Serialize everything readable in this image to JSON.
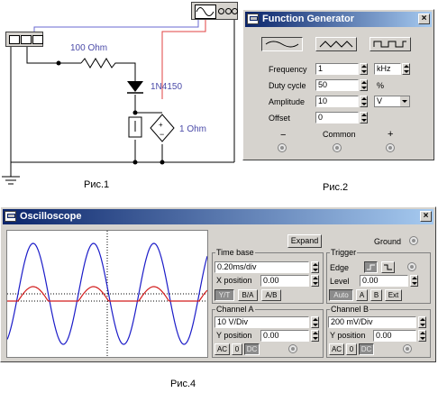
{
  "circuit": {
    "resistor_label": "100 Ohm",
    "diode_label": "1N4150",
    "source_label": "1 Ohm",
    "caption": "Рис.1"
  },
  "function_generator": {
    "title": "Function Generator",
    "caption": "Рис.2",
    "waveforms": [
      "sine-wave-icon",
      "triangle-wave-icon",
      "square-wave-icon"
    ],
    "frequency": {
      "label": "Frequency",
      "value": "1",
      "unit": "kHz"
    },
    "duty_cycle": {
      "label": "Duty cycle",
      "value": "50",
      "unit": "%"
    },
    "amplitude": {
      "label": "Amplitude",
      "value": "10",
      "unit": "V"
    },
    "offset": {
      "label": "Offset",
      "value": "0"
    },
    "terminals": {
      "minus": "−",
      "common": "Common",
      "plus": "+"
    }
  },
  "oscilloscope": {
    "title": "Oscilloscope",
    "caption": "Рис.4",
    "expand_label": "Expand",
    "ground_label": "Ground",
    "timebase": {
      "title": "Time base",
      "value": "0.20ms/div",
      "xpos_label": "X position",
      "xpos_value": "0.00",
      "modes": [
        "Y/T",
        "B/A",
        "A/B"
      ]
    },
    "trigger": {
      "title": "Trigger",
      "edge_label": "Edge",
      "level_label": "Level",
      "level_value": "0.00",
      "modes": [
        "Auto",
        "A",
        "B",
        "Ext"
      ]
    },
    "channel_a": {
      "title": "Channel A",
      "value": "10  V/Div",
      "ypos_label": "Y position",
      "ypos_value": "0.00",
      "coupling": [
        "AC",
        "0",
        "DC"
      ]
    },
    "channel_b": {
      "title": "Channel B",
      "value": "200 mV/Div",
      "ypos_label": "Y position",
      "ypos_value": "0.00",
      "coupling": [
        "AC",
        "0",
        "DC"
      ]
    },
    "traces": {
      "channel_a_color": "#1c1cc8",
      "channel_b_color": "#d21c1c"
    }
  },
  "colors": {
    "title_start": "#0a246a",
    "title_end": "#a6caf0",
    "window_bg": "#d6d3ce",
    "wire_blue": "#6a6ad0",
    "wire_red": "#e04040"
  }
}
